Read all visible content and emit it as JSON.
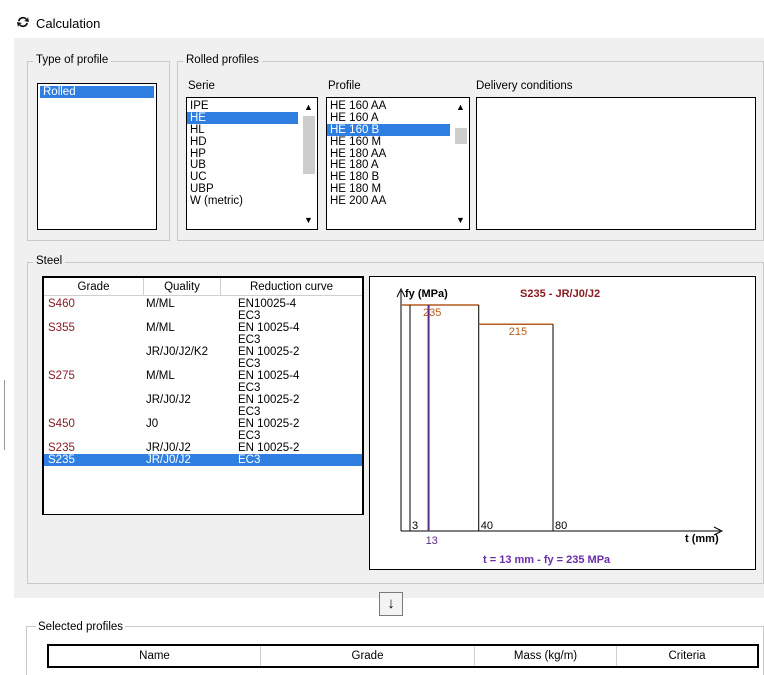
{
  "window": {
    "title": "Calculation"
  },
  "type_of_profile": {
    "label": "Type of profile",
    "items": [
      "Rolled"
    ],
    "selected_index": 0
  },
  "rolled_profiles": {
    "label": "Rolled profiles",
    "serie": {
      "label": "Serie",
      "items": [
        "IPE",
        "HE",
        "HL",
        "HD",
        "HP",
        "UB",
        "UC",
        "UBP",
        "W (metric)"
      ],
      "selected_index": 1
    },
    "profile": {
      "label": "Profile",
      "items": [
        "HE 160 AA",
        "HE 160 A",
        "HE 160 B",
        "HE 160 M",
        "HE 180 AA",
        "HE 180 A",
        "HE 180 B",
        "HE 180 M",
        "HE 200 AA"
      ],
      "selected_index": 2
    },
    "delivery": {
      "label": "Delivery conditions"
    }
  },
  "steel": {
    "label": "Steel",
    "columns": [
      "Grade",
      "Quality",
      "Reduction curve"
    ],
    "rows": [
      {
        "grade": "S460",
        "quality": "M/ML",
        "curve1": "EN10025-4",
        "curve2": "EC3"
      },
      {
        "grade": "S355",
        "quality": "M/ML",
        "curve1": "EN 10025-4",
        "curve2": "EC3"
      },
      {
        "grade": "",
        "quality": "JR/J0/J2/K2",
        "curve1": "EN 10025-2",
        "curve2": "EC3"
      },
      {
        "grade": "S275",
        "quality": "M/ML",
        "curve1": "EN 10025-4",
        "curve2": "EC3"
      },
      {
        "grade": "",
        "quality": "JR/J0/J2",
        "curve1": "EN 10025-2",
        "curve2": "EC3"
      },
      {
        "grade": "S450",
        "quality": "J0",
        "curve1": "EN 10025-2",
        "curve2": "EC3"
      },
      {
        "grade": "S235",
        "quality": "JR/J0/J2",
        "curve1": "EN 10025-2",
        "curve2": ""
      },
      {
        "grade": "S235",
        "quality": "JR/J0/J2",
        "curve1": "EC3",
        "curve2": ""
      }
    ],
    "selected_row": 7
  },
  "chart_data": {
    "type": "line",
    "title": "S235 - JR/J0/J2",
    "ylabel": "fy (MPa)",
    "xlabel": "t (mm)",
    "x_ticks": [
      "3",
      "40",
      "80"
    ],
    "segments": [
      {
        "t_from": 0,
        "t_to": 40,
        "fy": 235,
        "label": "235"
      },
      {
        "t_from": 40,
        "t_to": 80,
        "fy": 215,
        "label": "215"
      }
    ],
    "marker": {
      "t": 13,
      "label": "13"
    },
    "result_text": "t = 13 mm   -  fy = 235 MPa",
    "colors": {
      "step": "#b35c1e",
      "marker": "#5b2a86",
      "result": "#6a2da8",
      "title": "#8a1b24"
    }
  },
  "buttons": {
    "down_arrow": "↓"
  },
  "selected_profiles": {
    "label": "Selected profiles",
    "columns": [
      "Name",
      "Grade",
      "Mass (kg/m)",
      "Criteria"
    ]
  }
}
